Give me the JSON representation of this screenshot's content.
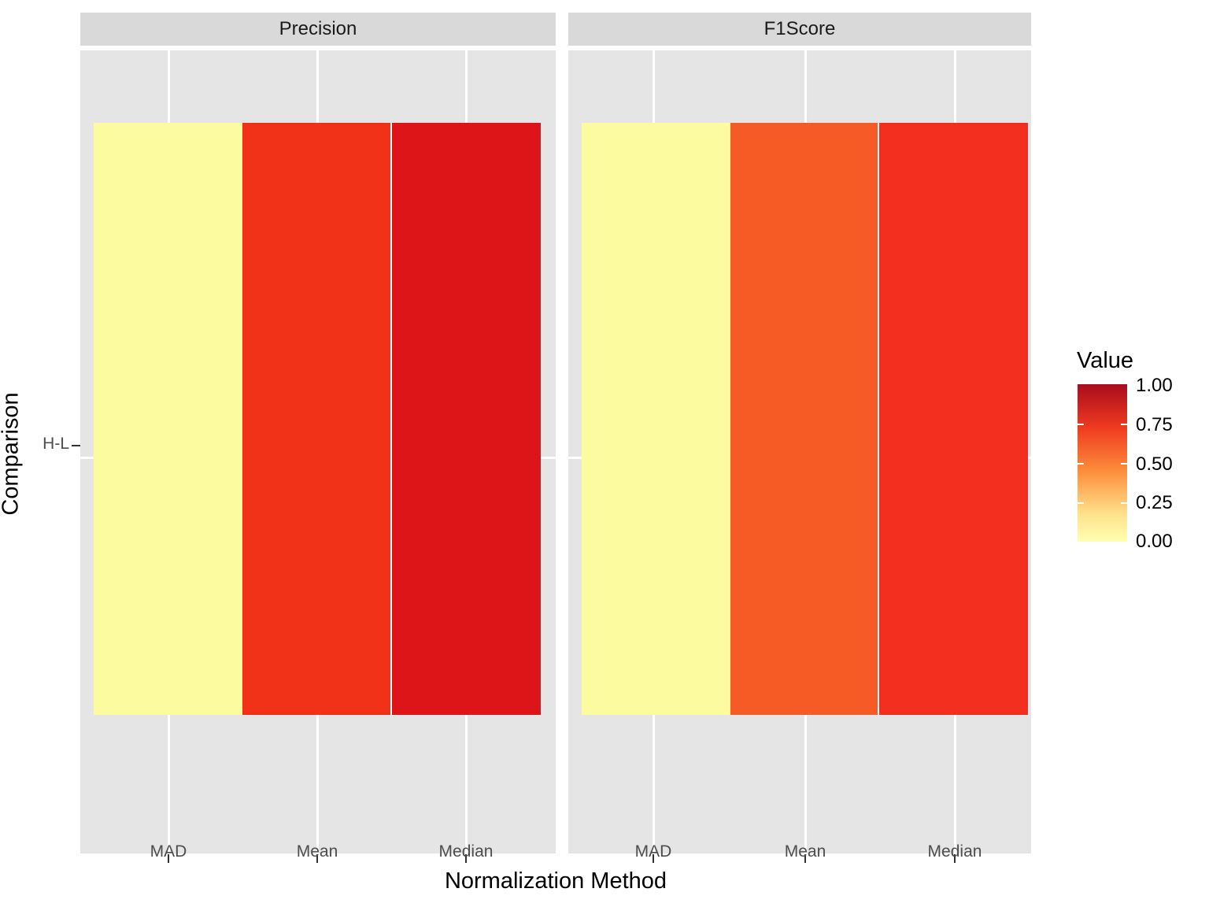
{
  "chart_data": {
    "type": "heatmap",
    "title": "",
    "xlabel": "Normalization Method",
    "ylabel": "Comparison",
    "categories": [
      "MAD",
      "Mean",
      "Median"
    ],
    "rows": [
      "H-L"
    ],
    "facets": [
      {
        "label": "Precision",
        "cells": [
          {
            "x": "MAD",
            "y": "H-L",
            "value": 0.0,
            "color": "#FDFB9F"
          },
          {
            "x": "Mean",
            "y": "H-L",
            "value": 0.83,
            "color": "#F23119"
          },
          {
            "x": "Median",
            "y": "H-L",
            "value": 0.92,
            "color": "#DD1418"
          }
        ]
      },
      {
        "label": "F1Score",
        "cells": [
          {
            "x": "MAD",
            "y": "H-L",
            "value": 0.0,
            "color": "#FDFB9F"
          },
          {
            "x": "Mean",
            "y": "H-L",
            "value": 0.7,
            "color": "#F65B26"
          },
          {
            "x": "Median",
            "y": "H-L",
            "value": 0.81,
            "color": "#F33020"
          }
        ]
      }
    ],
    "legend": {
      "title": "Value",
      "position": "right",
      "ticks": [
        "1.00",
        "0.75",
        "0.50",
        "0.25",
        "0.00"
      ],
      "limits": [
        0.0,
        1.0
      ],
      "gradient_low": "#FFFFB2",
      "gradient_mid": "#FD8D3C",
      "gradient_high": "#A90B1E"
    },
    "grid": true,
    "panel_background": "#E5E5E5",
    "strip_background": "#D9D9D9"
  },
  "axes": {
    "x_title": "Normalization Method",
    "y_title": "Comparison",
    "x_ticks": [
      "MAD",
      "Mean",
      "Median"
    ],
    "y_ticks": [
      "H-L"
    ]
  },
  "facet_labels": {
    "left": "Precision",
    "right": "F1Score"
  },
  "legend": {
    "title": "Value",
    "tick_1": "1.00",
    "tick_2": "0.75",
    "tick_3": "0.50",
    "tick_4": "0.25",
    "tick_5": "0.00"
  }
}
